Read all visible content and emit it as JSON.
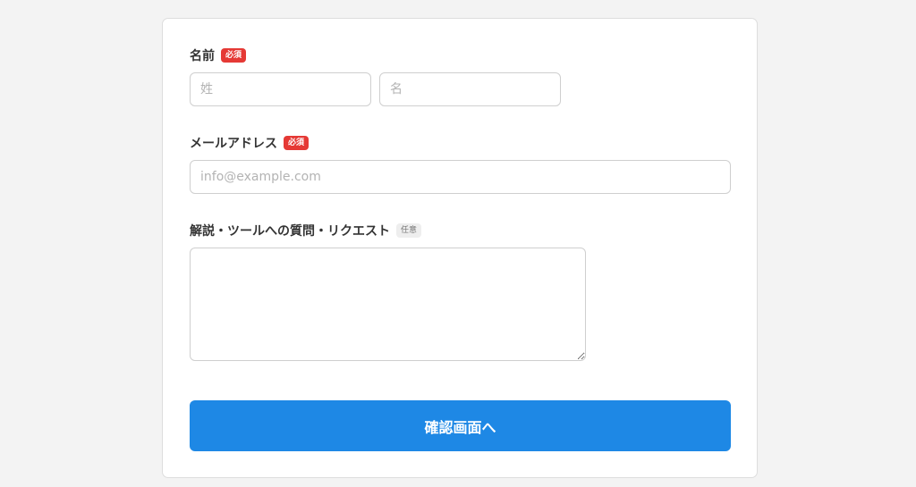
{
  "form": {
    "name": {
      "label": "名前",
      "badge": "必須",
      "last_placeholder": "姓",
      "first_placeholder": "名",
      "last_value": "",
      "first_value": ""
    },
    "email": {
      "label": "メールアドレス",
      "badge": "必須",
      "placeholder": "info@example.com",
      "value": ""
    },
    "message": {
      "label": "解説・ツールへの質問・リクエスト",
      "badge": "任意",
      "value": ""
    },
    "submit_label": "確認画面へ"
  },
  "colors": {
    "required_badge": "#e53935",
    "optional_badge": "#eeeeee",
    "primary_button": "#1e88e5",
    "background": "#f3f3f3"
  }
}
